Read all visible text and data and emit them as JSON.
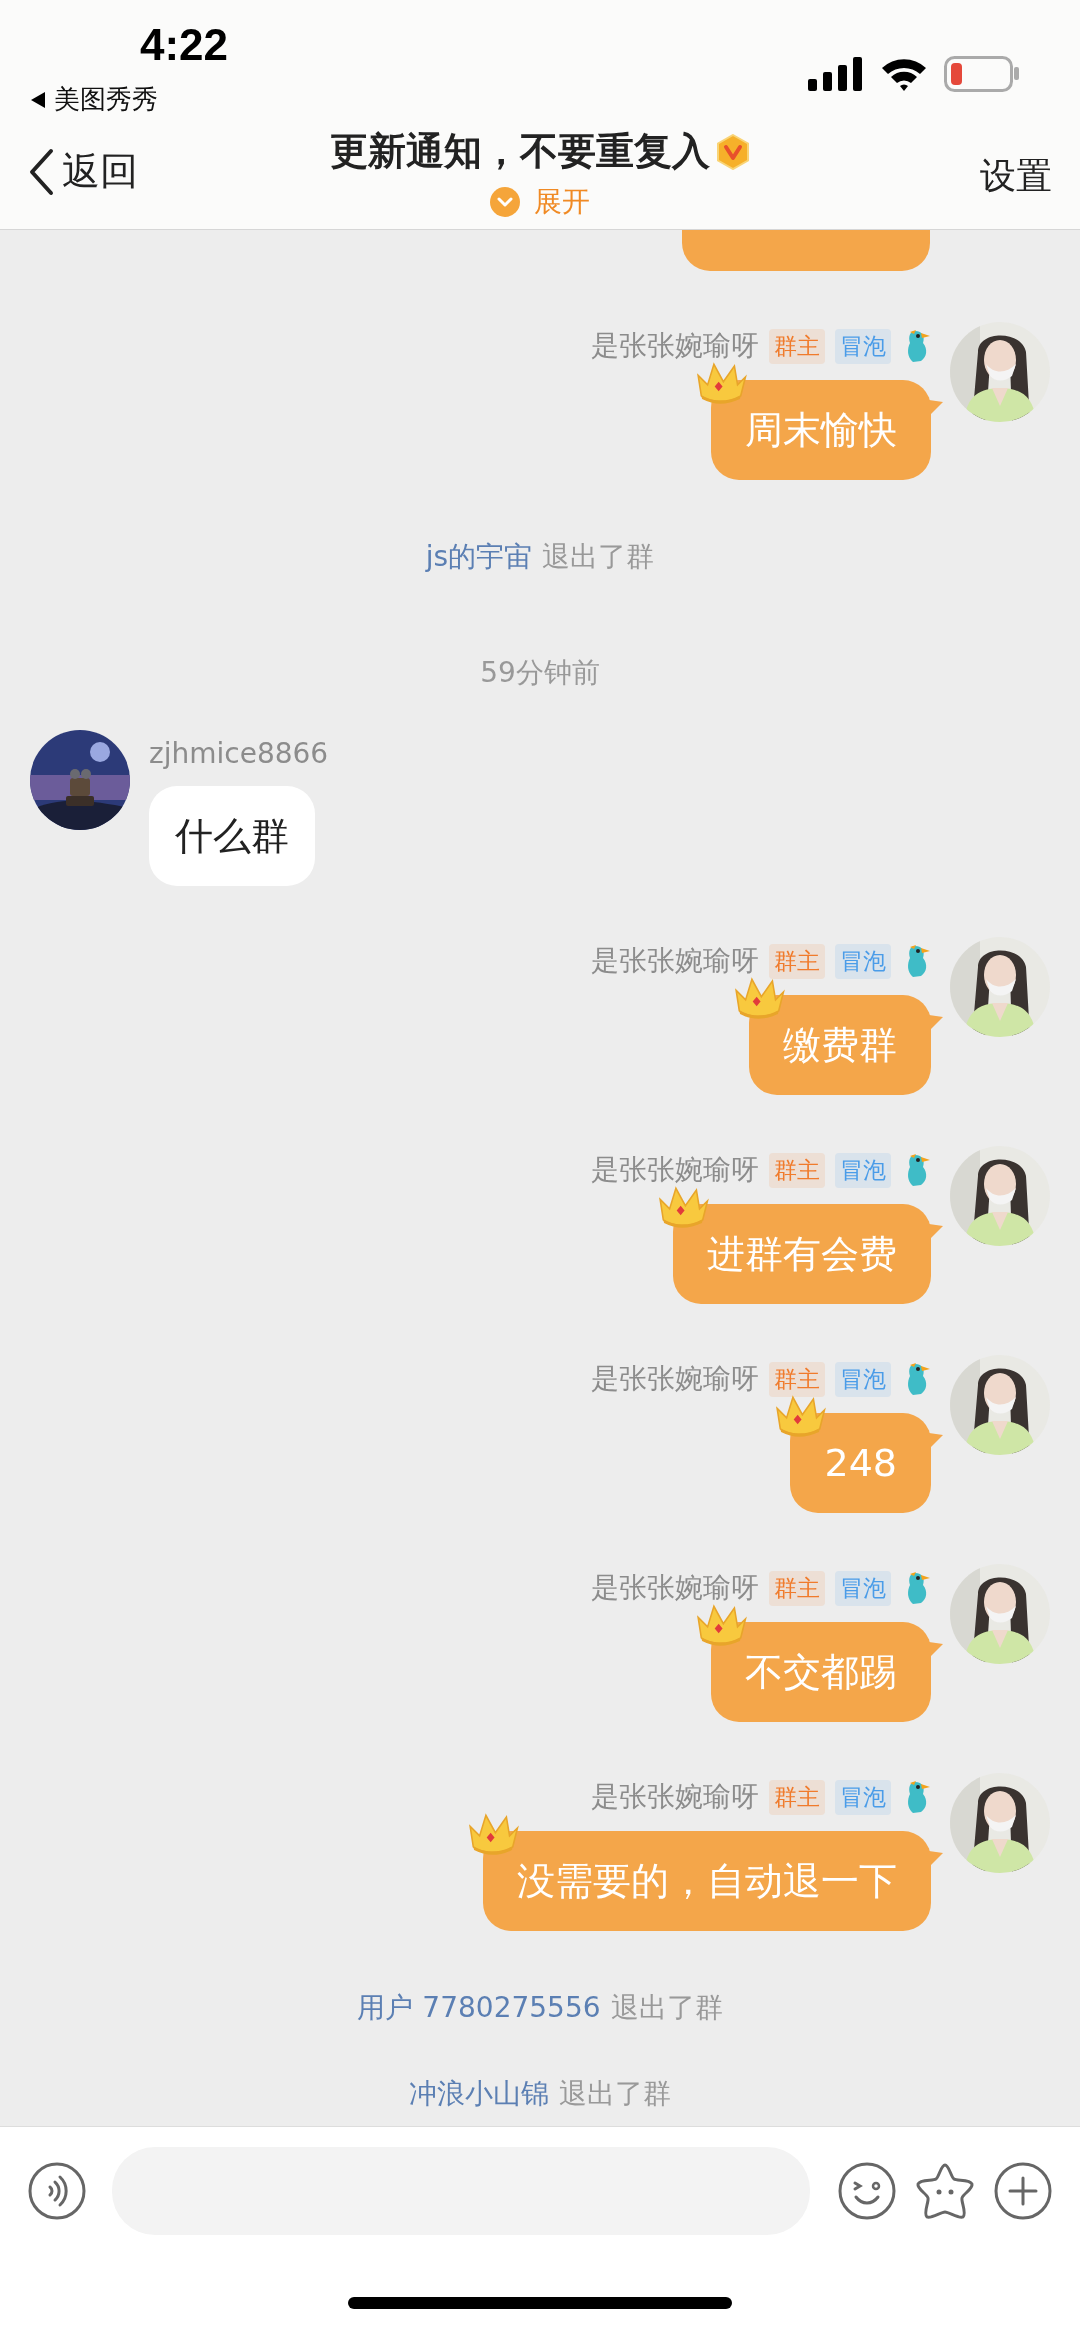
{
  "status_bar": {
    "time": "4:22",
    "back_app": "美图秀秀"
  },
  "header": {
    "back_label": "返回",
    "title": "更新通知，不要重复入",
    "expand_label": "展开",
    "settings_label": "设置"
  },
  "messages": [
    {
      "kind": "partial"
    },
    {
      "kind": "outgoing",
      "sender": "是张张婉瑜呀",
      "tags": [
        {
          "label": "群主",
          "color": "#f07b2c"
        },
        {
          "label": "冒泡",
          "color": "#4a9ce8"
        }
      ],
      "text": "周末愉快"
    },
    {
      "kind": "system",
      "user": "js的宇宙",
      "action": "退出了群"
    },
    {
      "kind": "time",
      "text": "59分钟前"
    },
    {
      "kind": "incoming",
      "sender": "zjhmice8866",
      "text": "什么群"
    },
    {
      "kind": "outgoing",
      "sender": "是张张婉瑜呀",
      "tags": [
        {
          "label": "群主",
          "color": "#f07b2c"
        },
        {
          "label": "冒泡",
          "color": "#4a9ce8"
        }
      ],
      "text": "缴费群"
    },
    {
      "kind": "outgoing",
      "sender": "是张张婉瑜呀",
      "tags": [
        {
          "label": "群主",
          "color": "#f07b2c"
        },
        {
          "label": "冒泡",
          "color": "#4a9ce8"
        }
      ],
      "text": "进群有会费"
    },
    {
      "kind": "outgoing",
      "sender": "是张张婉瑜呀",
      "tags": [
        {
          "label": "群主",
          "color": "#f07b2c"
        },
        {
          "label": "冒泡",
          "color": "#4a9ce8"
        }
      ],
      "text": "248"
    },
    {
      "kind": "outgoing",
      "sender": "是张张婉瑜呀",
      "tags": [
        {
          "label": "群主",
          "color": "#f07b2c"
        },
        {
          "label": "冒泡",
          "color": "#4a9ce8"
        }
      ],
      "text": "不交都踢"
    },
    {
      "kind": "outgoing",
      "sender": "是张张婉瑜呀",
      "tags": [
        {
          "label": "群主",
          "color": "#f07b2c"
        },
        {
          "label": "冒泡",
          "color": "#4a9ce8"
        }
      ],
      "text": "没需要的，自动退一下"
    },
    {
      "kind": "system",
      "user": "用户 7780275556",
      "action": "退出了群"
    },
    {
      "kind": "system",
      "user": "冲浪小山锦",
      "action": "退出了群"
    }
  ]
}
